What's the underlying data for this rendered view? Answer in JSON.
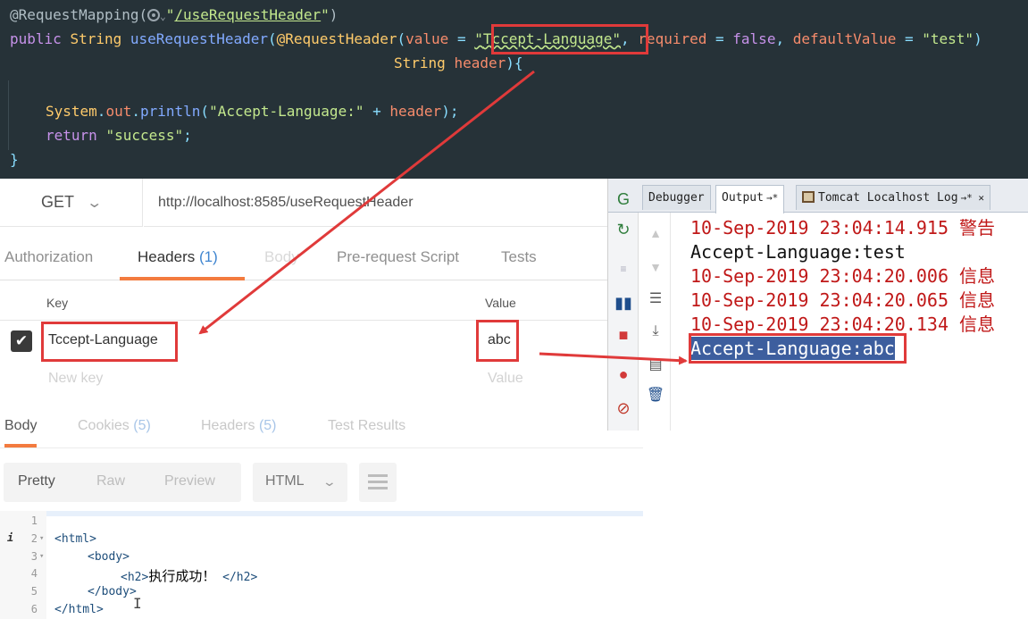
{
  "code": {
    "annotation": "@RequestMapping(",
    "mapping_path": "/useRequestHeader",
    "public_kw": "public",
    "return_type": "String",
    "method_name": "useRequestHeader",
    "req_header_ann": "@RequestHeader",
    "value_param": "value",
    "header_name": "Tccept-Language",
    "required_param": "required",
    "false_kw": "false",
    "default_param": "defaultValue",
    "default_value": "test",
    "string_type": "String",
    "param_name": "header",
    "sys": "System",
    "out_field": "out",
    "println": "println",
    "print_prefix": "Accept-Language:",
    "header_var": "header",
    "return_kw": "return",
    "return_value": "success"
  },
  "request": {
    "method": "GET",
    "url": "http://localhost:8585/useRequestHeader",
    "tabs": {
      "authorization": "Authorization",
      "headers": "Headers",
      "headers_count": "(1)",
      "body": "Body",
      "prerequest": "Pre-request Script",
      "tests": "Tests"
    },
    "table": {
      "key_header": "Key",
      "value_header": "Value",
      "row_key": "Tccept-Language",
      "row_value": "abc",
      "key_placeholder": "New key",
      "value_placeholder": "Value"
    }
  },
  "response": {
    "tabs": {
      "body": "Body",
      "cookies": "Cookies",
      "cookies_count": "(5)",
      "headers": "Headers",
      "headers_count": "(5)",
      "test_results": "Test Results"
    },
    "format": {
      "pretty": "Pretty",
      "raw": "Raw",
      "preview": "Preview",
      "lang": "HTML"
    },
    "code_lines": {
      "n1": "1",
      "n2": "2",
      "n3": "3",
      "n4": "4",
      "n5": "5",
      "n6": "6",
      "l2": "<html>",
      "l3": "<body>",
      "l4_open": "<h2>",
      "l4_text": "执行成功！",
      "l4_close": "</h2>",
      "l5": "</body>",
      "l6": "</html>",
      "info": "i"
    }
  },
  "output": {
    "tabs": {
      "debugger": "Debugger",
      "output": "Output",
      "tomcat": "Tomcat Localhost Log"
    },
    "lines": [
      "10-Sep-2019 23:04:14.915 警告",
      "Accept-Language:test",
      "10-Sep-2019 23:04:20.006 信息",
      "10-Sep-2019 23:04:20.065 信息",
      "10-Sep-2019 23:04:20.134 信息",
      "Accept-Language:abc"
    ]
  },
  "colors": {
    "highlight_red": "#e03a3a",
    "active_tab_orange": "#f37b3f",
    "editor_bg": "#263238"
  }
}
